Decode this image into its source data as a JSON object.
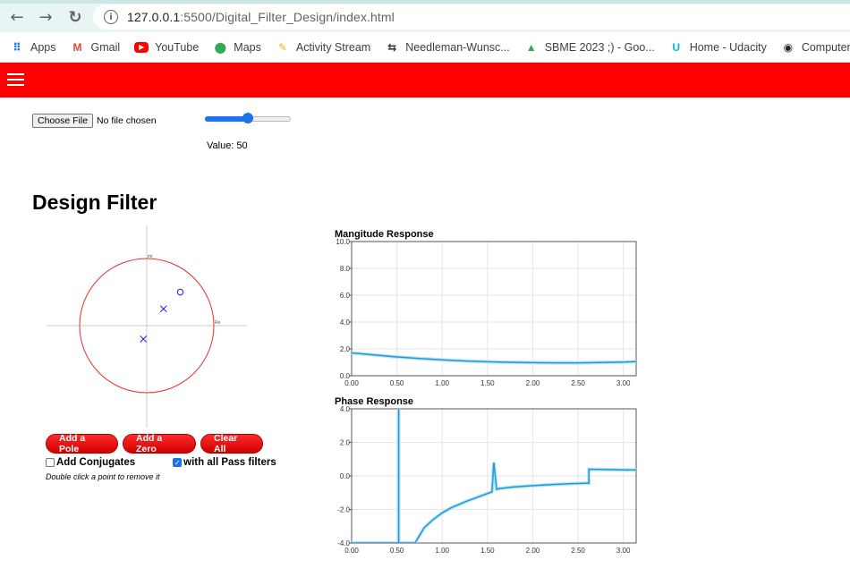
{
  "browser": {
    "url_host": "127.0.0.1",
    "url_rest": ":5500/Digital_Filter_Design/index.html",
    "bookmarks": [
      {
        "label": "Apps",
        "icon": "apps-grid-icon",
        "color": "#1a73e8"
      },
      {
        "label": "Gmail",
        "icon": "gmail-icon",
        "color": "#ea4335"
      },
      {
        "label": "YouTube",
        "icon": "youtube-icon",
        "color": "#ff0000"
      },
      {
        "label": "Maps",
        "icon": "maps-pin-icon",
        "color": "#34a853"
      },
      {
        "label": "Activity Stream",
        "icon": "activity-stream-icon",
        "color": "#f4b400"
      },
      {
        "label": "Needleman-Wunsc...",
        "icon": "needleman-icon",
        "color": "#333333"
      },
      {
        "label": "SBME 2023 ;) - Goo...",
        "icon": "google-drive-icon",
        "color": "#34a853"
      },
      {
        "label": "Home - Udacity",
        "icon": "udacity-icon",
        "color": "#02b3e4"
      },
      {
        "label": "Computer Gra",
        "icon": "globe-icon",
        "color": "#202124"
      }
    ]
  },
  "app": {
    "accent": "#ff0000",
    "choose_file_label": "Choose File",
    "no_file_text": "No file chosen",
    "slider_value": 50,
    "value_text": "Value: 50",
    "title": "Design Filter",
    "zplane": {
      "im_label": "im",
      "re_label": "Re",
      "poles": [
        {
          "re": 0.25,
          "im": 0.25
        },
        {
          "re": -0.05,
          "im": -0.2
        }
      ],
      "zeros": [
        {
          "re": 0.5,
          "im": 0.5
        }
      ]
    },
    "buttons": {
      "add_pole": "Add a Pole",
      "add_zero": "Add a Zero",
      "clear_all": "Clear All"
    },
    "add_conjugates_label": "Add Conjugates",
    "with_all_pass_label": "with all Pass filters",
    "hint": "Double click a point to remove it"
  },
  "chart_data": [
    {
      "type": "line",
      "title": "Mangitude Response",
      "ylim": [
        0,
        10
      ],
      "xlim": [
        0,
        3.1416
      ],
      "x_ticks": [
        "0.00",
        "0.50",
        "1.00",
        "1.50",
        "2.00",
        "2.50",
        "3.00"
      ],
      "y_ticks": [
        "0.0",
        "2.0",
        "4.0",
        "6.0",
        "8.0",
        "10.0"
      ],
      "grid": true,
      "color": "#1a9bd7",
      "x": [
        0,
        0.25,
        0.5,
        0.75,
        1.0,
        1.25,
        1.5,
        1.75,
        2.0,
        2.25,
        2.5,
        2.75,
        3.0,
        3.1416
      ],
      "y": [
        1.7,
        1.55,
        1.4,
        1.28,
        1.18,
        1.1,
        1.04,
        1.0,
        0.97,
        0.96,
        0.96,
        0.98,
        1.02,
        1.05
      ]
    },
    {
      "type": "line",
      "title": "Phase Response",
      "ylim": [
        -4,
        4
      ],
      "xlim": [
        0,
        3.1416
      ],
      "x_ticks": [
        "0.00",
        "0.50",
        "1.00",
        "1.50",
        "2.00",
        "2.50",
        "3.00"
      ],
      "y_ticks": [
        "-4.0",
        "-2.0",
        "0.0",
        "2.0",
        "4.0"
      ],
      "grid": true,
      "color": "#1a9bd7",
      "x": [
        0,
        0.52,
        0.52,
        0.52,
        0.7,
        0.8,
        0.9,
        1.0,
        1.1,
        1.25,
        1.4,
        1.55,
        1.57,
        1.6,
        1.63,
        1.8,
        2.0,
        2.2,
        2.4,
        2.6,
        2.62,
        2.62,
        2.8,
        3.0,
        3.1416
      ],
      "y": [
        -4,
        -4,
        4,
        -4,
        -4,
        -3.1,
        -2.6,
        -2.2,
        -1.9,
        -1.55,
        -1.25,
        -0.95,
        0.8,
        -0.8,
        -0.75,
        -0.65,
        -0.58,
        -0.52,
        -0.47,
        -0.43,
        -0.43,
        0.4,
        0.38,
        0.36,
        0.35
      ]
    }
  ]
}
